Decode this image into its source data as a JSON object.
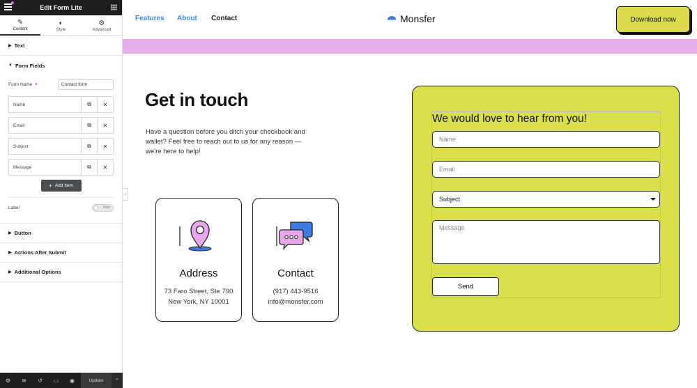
{
  "editor": {
    "title": "Edit Form Lite",
    "tabs": [
      {
        "label": "Content",
        "icon": "pencil-icon"
      },
      {
        "label": "Style",
        "icon": "contrast-icon"
      },
      {
        "label": "Advanced",
        "icon": "gear-icon"
      }
    ],
    "sections": {
      "text": "Text",
      "form_fields": "Form Fields",
      "button": "Button",
      "actions_after_submit": "Actions After Submit",
      "additional_options": "Additional Options"
    },
    "form_name_label": "Form Name",
    "form_name_value": "Contact form",
    "fields": [
      {
        "label": "Name"
      },
      {
        "label": "Email"
      },
      {
        "label": "Subject"
      },
      {
        "label": "Message"
      }
    ],
    "add_item_label": "Add Item",
    "label_label": "Label",
    "label_toggle": "Hide",
    "update_label": "Update"
  },
  "site": {
    "nav": {
      "links": [
        {
          "label": "Features",
          "color": "#4a86e8"
        },
        {
          "label": "About",
          "color": "#4a86e8"
        },
        {
          "label": "Contact",
          "color": "#222222"
        }
      ],
      "brand": "Monsfer",
      "cta": "Download now"
    },
    "hero": {
      "title": "Get in touch",
      "text": "Have a question before you ditch your checkbook and wallet? Feel free to reach out to us for any reason — we're here to help!"
    },
    "cards": [
      {
        "title": "Address",
        "icon": "map-pin-icon",
        "line1": "73 Faro Street, Ste 790",
        "line2": "New York, NY 10001"
      },
      {
        "title": "Contact",
        "icon": "chat-bubbles-icon",
        "line1": "(917) 443-9516",
        "line2": "info@monsfer.com"
      }
    ],
    "form": {
      "title": "We would love to hear from you!",
      "name_placeholder": "Name",
      "email_placeholder": "Email",
      "subject_value": "Subject",
      "message_placeholder": "Message",
      "send_label": "Send"
    },
    "colors": {
      "accent_yellow": "#dadf4c",
      "stripe_pink": "#e7b1ee",
      "link_blue": "#4a86e8"
    }
  }
}
